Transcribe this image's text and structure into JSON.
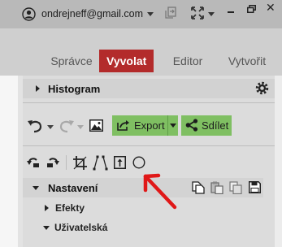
{
  "window": {
    "account_email": "ondrejneff@gmail.com"
  },
  "modules": {
    "tabs": [
      {
        "label": "Správce",
        "active": false
      },
      {
        "label": "Vyvolat",
        "active": true
      },
      {
        "label": "Editor",
        "active": false
      },
      {
        "label": "Vytvořit",
        "active": false
      }
    ]
  },
  "panel": {
    "histogram_label": "Histogram",
    "export_label": "Export",
    "share_label": "Sdílet",
    "settings_label": "Nastavení",
    "effects_label": "Efekty",
    "user_label": "Uživatelská"
  },
  "colors": {
    "accent_tab": "#b32b2b",
    "button_green": "#7fbf62",
    "annotation_red": "#e01818"
  }
}
